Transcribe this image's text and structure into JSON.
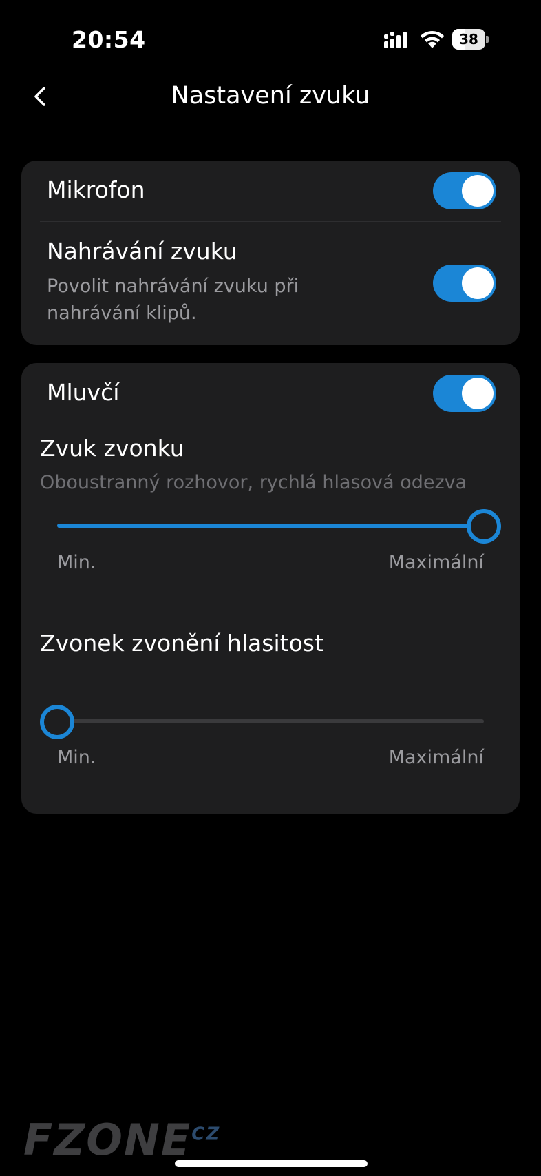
{
  "status_bar": {
    "time": "20:54",
    "battery_level": "38",
    "battery_fraction": 0.38
  },
  "nav": {
    "title": "Nastavení zvuku",
    "back_icon": "chevron-left-icon"
  },
  "section_microphone": {
    "mikrofon_label": "Mikrofon",
    "mikrofon_on": true,
    "recording_label": "Nahrávání zvuku",
    "recording_desc_line1": "Povolit nahrávání zvuku při",
    "recording_desc_line2": "nahrávání klipů.",
    "recording_on": true
  },
  "section_speaker": {
    "speaker_label": "Mluvčí",
    "speaker_on": true,
    "bell_sound_title": "Zvuk zvonku",
    "bell_sound_desc": "Oboustranný rozhovor, rychlá hlasová odezva",
    "bell_sound_level": 1.0,
    "bell_volume_title": "Zvonek zvonění hlasitost",
    "bell_volume_level": 0.0,
    "slider_min_label": "Min.",
    "slider_max_label": "Maximální"
  },
  "watermark": {
    "text": "FZONE",
    "suffix": "CZ"
  },
  "colors": {
    "accent": "#1b86d6",
    "card_bg": "#1e1e1f",
    "background": "#000000"
  }
}
